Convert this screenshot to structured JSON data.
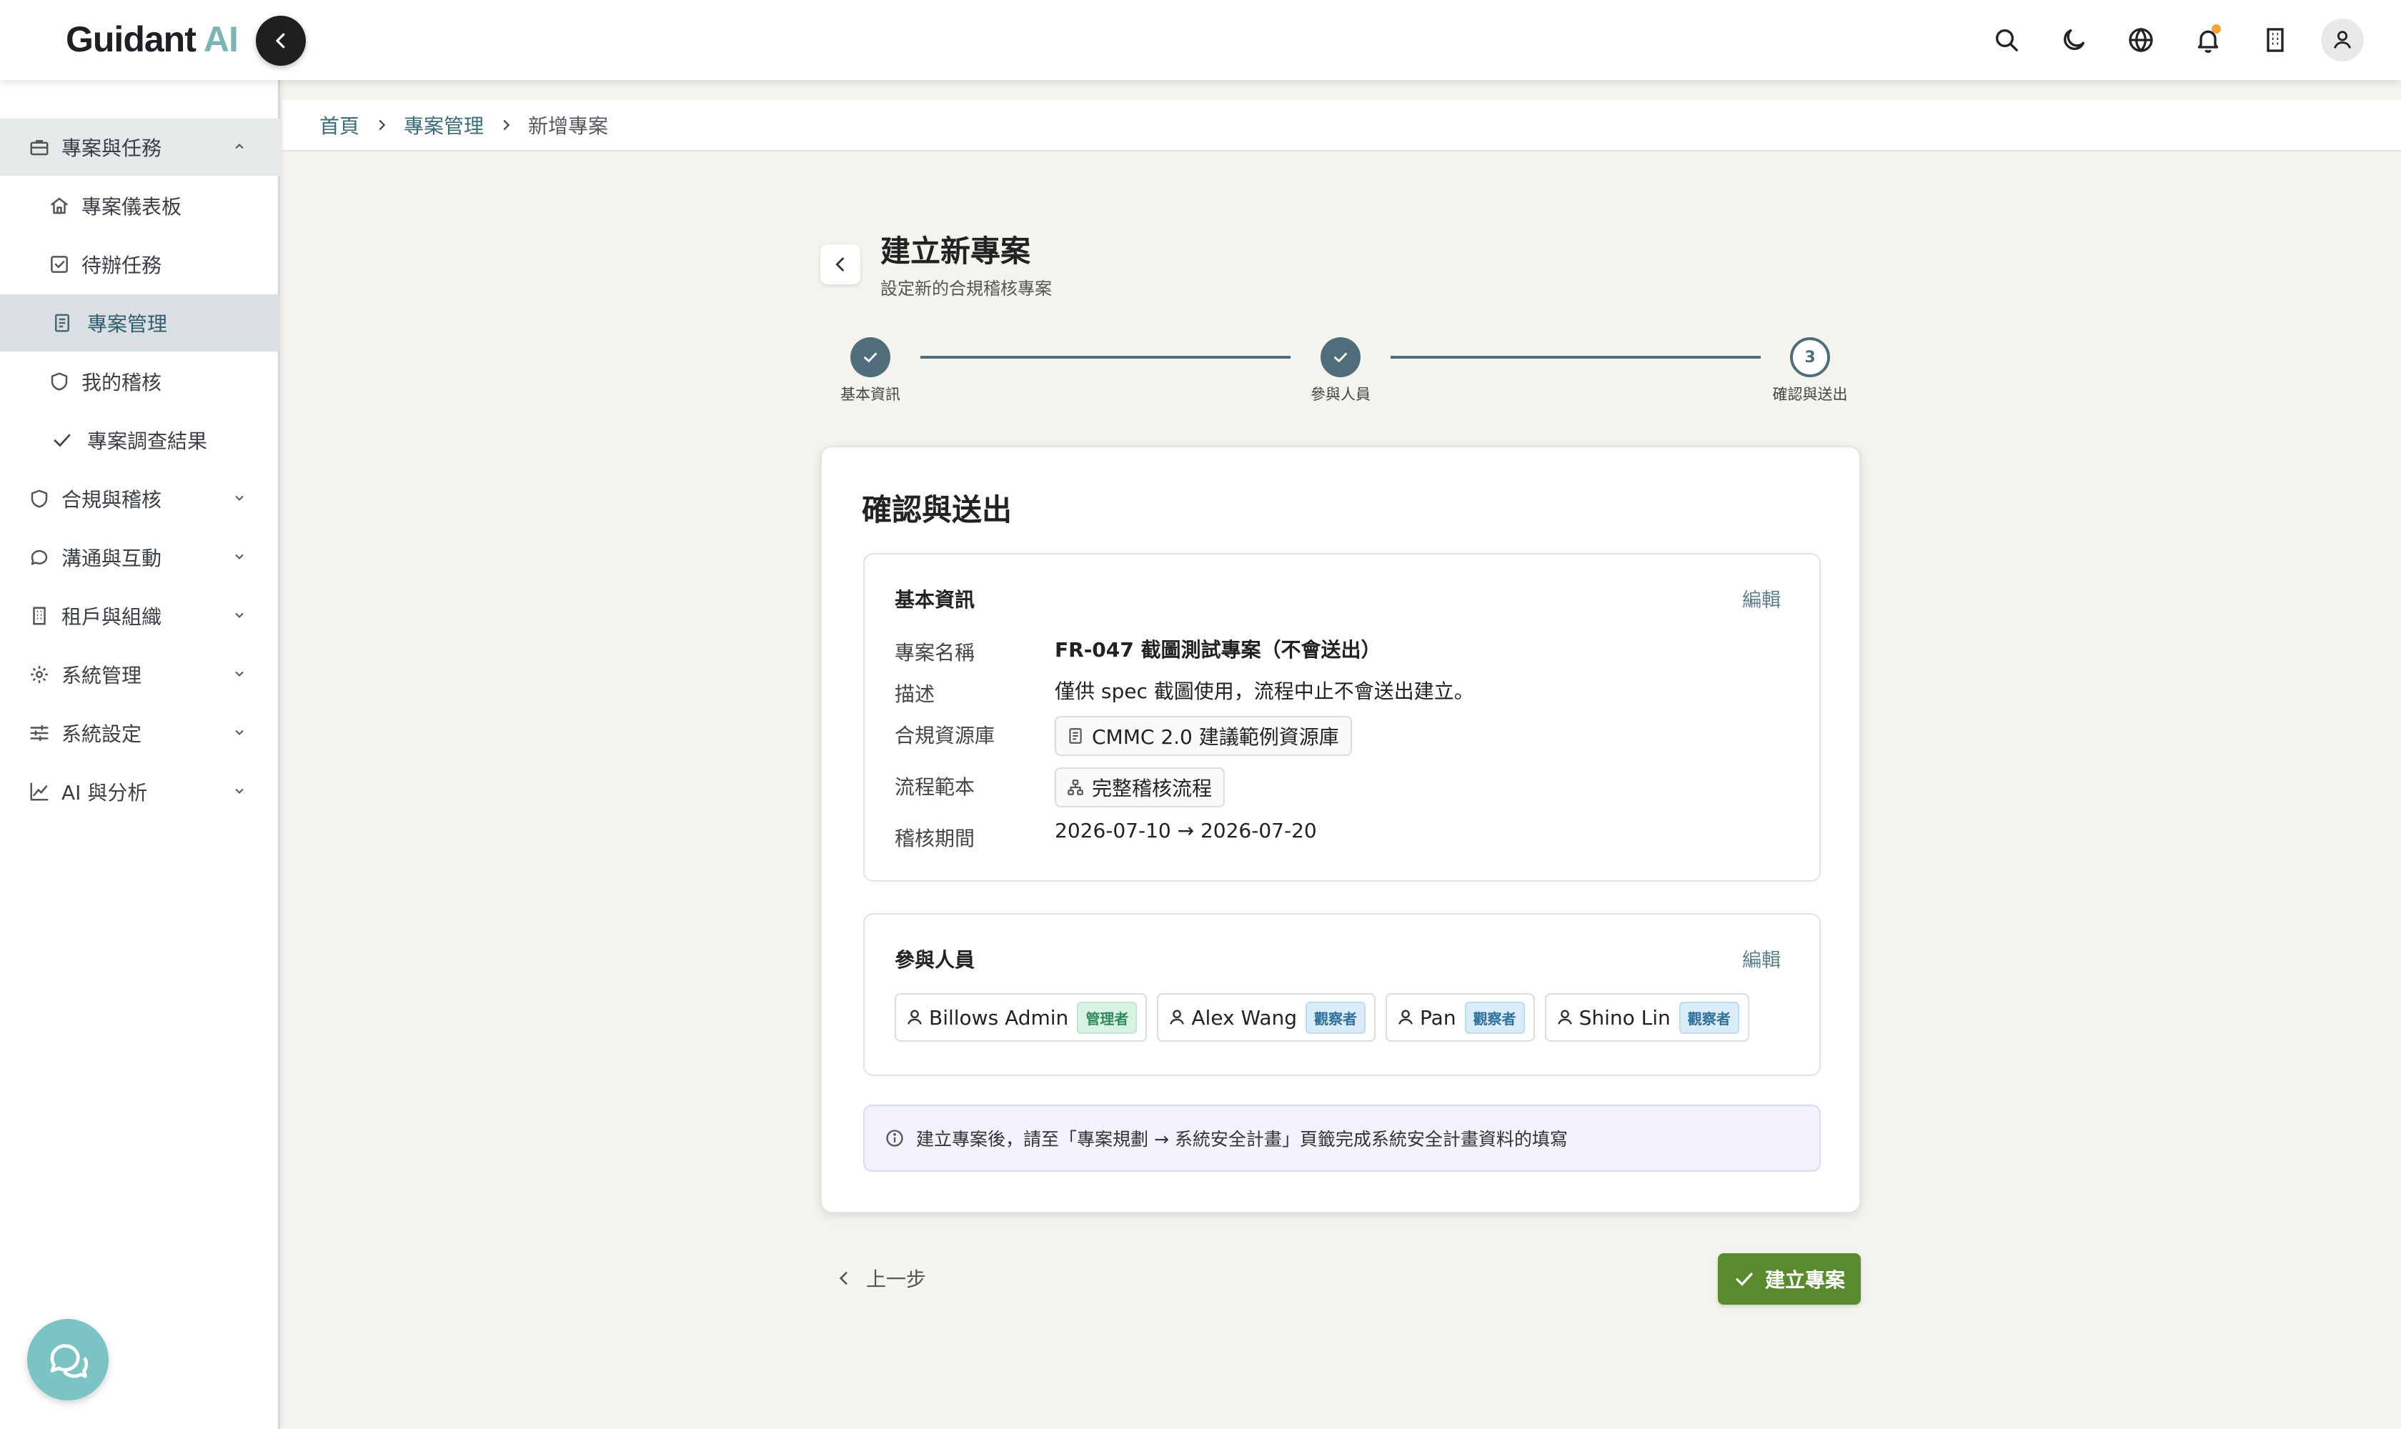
{
  "header": {
    "logo_main": "Guidant",
    "logo_ai": "AI",
    "icons": [
      "search-icon",
      "moon-icon",
      "globe-icon",
      "bell-icon",
      "building-icon",
      "user-icon"
    ]
  },
  "sidebar": {
    "items": [
      {
        "label": "專案與任務",
        "icon": "briefcase-icon",
        "expanded": true
      },
      {
        "label": "專案儀表板",
        "icon": "home-icon"
      },
      {
        "label": "待辦任務",
        "icon": "checkbox-icon"
      },
      {
        "label": "專案管理",
        "icon": "document-icon",
        "active": true
      },
      {
        "label": "我的稽核",
        "icon": "shield-icon"
      },
      {
        "label": "專案調查結果",
        "icon": "check-icon"
      },
      {
        "label": "合規與稽核",
        "icon": "shield-icon"
      },
      {
        "label": "溝通與互動",
        "icon": "chat-icon"
      },
      {
        "label": "租戶與組織",
        "icon": "building-icon"
      },
      {
        "label": "系統管理",
        "icon": "gear-icon"
      },
      {
        "label": "系統設定",
        "icon": "sliders-icon"
      },
      {
        "label": "AI 與分析",
        "icon": "chart-icon"
      }
    ]
  },
  "breadcrumb": {
    "home": "首頁",
    "section": "專案管理",
    "current": "新增專案"
  },
  "page": {
    "title": "建立新專案",
    "subtitle": "設定新的合規稽核專案"
  },
  "stepper": {
    "steps": [
      {
        "label": "基本資訊",
        "state": "done"
      },
      {
        "label": "參與人員",
        "state": "done"
      },
      {
        "label": "確認與送出",
        "state": "current",
        "number": "3"
      }
    ]
  },
  "card": {
    "title": "確認與送出",
    "basic": {
      "title": "基本資訊",
      "edit": "編輯",
      "name_label": "專案名稱",
      "name_value": "FR-047 截圖測試專案（不會送出）",
      "desc_label": "描述",
      "desc_value": "僅供 spec 截圖使用，流程中止不會送出建立。",
      "library_label": "合規資源庫",
      "library_value": "CMMC 2.0 建議範例資源庫",
      "template_label": "流程範本",
      "template_value": "完整稽核流程",
      "period_label": "稽核期間",
      "period_value": "2026-07-10 → 2026-07-20"
    },
    "people": {
      "title": "參與人員",
      "edit": "編輯",
      "members": [
        {
          "name": "Billows Admin",
          "role": "管理者",
          "role_type": "admin"
        },
        {
          "name": "Alex Wang",
          "role": "觀察者",
          "role_type": "viewer"
        },
        {
          "name": "Pan",
          "role": "觀察者",
          "role_type": "viewer"
        },
        {
          "name": "Shino Lin",
          "role": "觀察者",
          "role_type": "viewer"
        }
      ]
    },
    "notice": "建立專案後，請至「專案規劃 → 系統安全計畫」頁籤完成系統安全計畫資料的填寫"
  },
  "actions": {
    "prev": "上一步",
    "submit": "建立專案"
  },
  "colors": {
    "accent": "#4f6d7a",
    "submit": "#5a8a2e",
    "logo_ai": "#7cb3b4",
    "chat_fab": "#7cc3c4"
  }
}
